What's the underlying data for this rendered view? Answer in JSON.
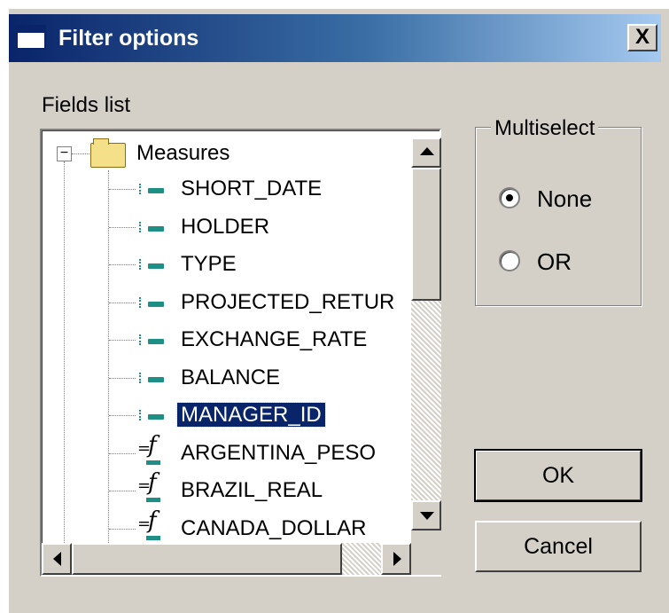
{
  "window": {
    "title": "Filter options",
    "close_label": "X"
  },
  "fields_list": {
    "label": "Fields list",
    "root": {
      "label": "Measures",
      "expander": "−"
    },
    "items": [
      {
        "label": "SHORT_DATE",
        "icon": "dimension-icon",
        "selected": false
      },
      {
        "label": "HOLDER",
        "icon": "dimension-icon",
        "selected": false
      },
      {
        "label": "TYPE",
        "icon": "dimension-icon",
        "selected": false
      },
      {
        "label": "PROJECTED_RETUR",
        "icon": "dimension-icon",
        "selected": false
      },
      {
        "label": "EXCHANGE_RATE",
        "icon": "dimension-icon",
        "selected": false
      },
      {
        "label": "BALANCE",
        "icon": "dimension-icon",
        "selected": false
      },
      {
        "label": "MANAGER_ID",
        "icon": "dimension-icon",
        "selected": true
      },
      {
        "label": "ARGENTINA_PESO",
        "icon": "calculated-field-icon",
        "selected": false
      },
      {
        "label": "BRAZIL_REAL",
        "icon": "calculated-field-icon",
        "selected": false
      },
      {
        "label": "CANADA_DOLLAR",
        "icon": "calculated-field-icon",
        "selected": false
      }
    ]
  },
  "multiselect": {
    "label": "Multiselect",
    "options": [
      {
        "label": "None",
        "checked": true
      },
      {
        "label": "OR",
        "checked": false
      }
    ]
  },
  "buttons": {
    "ok": "OK",
    "cancel": "Cancel"
  },
  "colors": {
    "title_bar": "#0a246a",
    "selection": "#0a246a",
    "dialog_bg": "#d4d0c8",
    "icon_teal": "#1e8f85"
  }
}
